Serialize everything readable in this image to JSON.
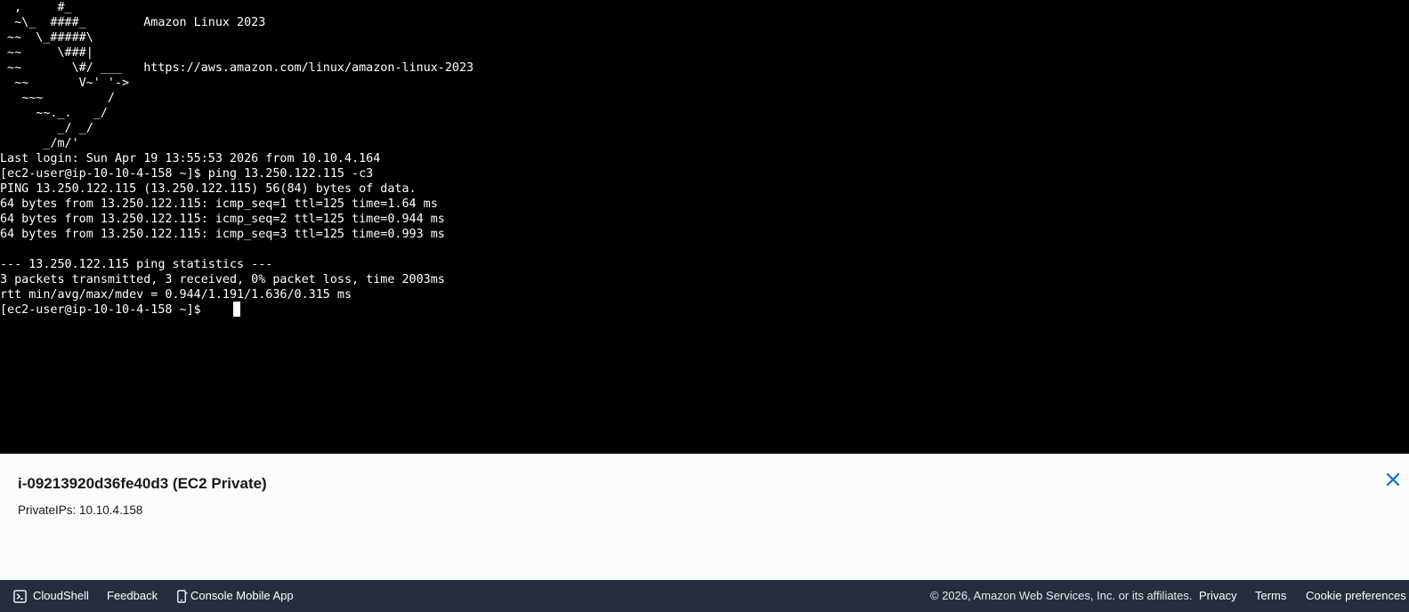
{
  "terminal": {
    "lines": [
      "  ,     #_",
      "  ~\\_  ####_        Amazon Linux 2023",
      " ~~  \\_#####\\",
      " ~~     \\###|",
      " ~~       \\#/ ___   https://aws.amazon.com/linux/amazon-linux-2023",
      "  ~~       V~' '->",
      "   ~~~         /",
      "     ~~._.   _/",
      "        _/ _/",
      "      _/m/'",
      "Last login: Sun Apr 19 13:55:53 2026 from 10.10.4.164",
      "[ec2-user@ip-10-10-4-158 ~]$ ping 13.250.122.115 -c3",
      "PING 13.250.122.115 (13.250.122.115) 56(84) bytes of data.",
      "64 bytes from 13.250.122.115: icmp_seq=1 ttl=125 time=1.64 ms",
      "64 bytes from 13.250.122.115: icmp_seq=2 ttl=125 time=0.944 ms",
      "64 bytes from 13.250.122.115: icmp_seq=3 ttl=125 time=0.993 ms",
      "",
      "--- 13.250.122.115 ping statistics ---",
      "3 packets transmitted, 3 received, 0% packet loss, time 2003ms",
      "rtt min/avg/max/mdev = 0.944/1.191/1.636/0.315 ms",
      "[ec2-user@ip-10-10-4-158 ~]$ "
    ]
  },
  "instance": {
    "title": "i-09213920d36fe40d3 (EC2 Private)",
    "private_ips": "PrivateIPs: 10.10.4.158",
    "close_icon": "close-icon"
  },
  "footer": {
    "cloudshell": "CloudShell",
    "cloudshell_icon": "terminal-icon",
    "feedback": "Feedback",
    "mobile_app": "Console Mobile App",
    "mobile_icon": "mobile-phone-icon",
    "copyright": "© 2026, Amazon Web Services, Inc. or its affiliates.",
    "privacy": "Privacy",
    "terms": "Terms",
    "cookie_preferences": "Cookie preferences"
  },
  "colors": {
    "terminal_bg": "#000000",
    "terminal_fg": "#ffffff",
    "footer_bg": "#232f3e",
    "close_icon": "#0972d3"
  }
}
